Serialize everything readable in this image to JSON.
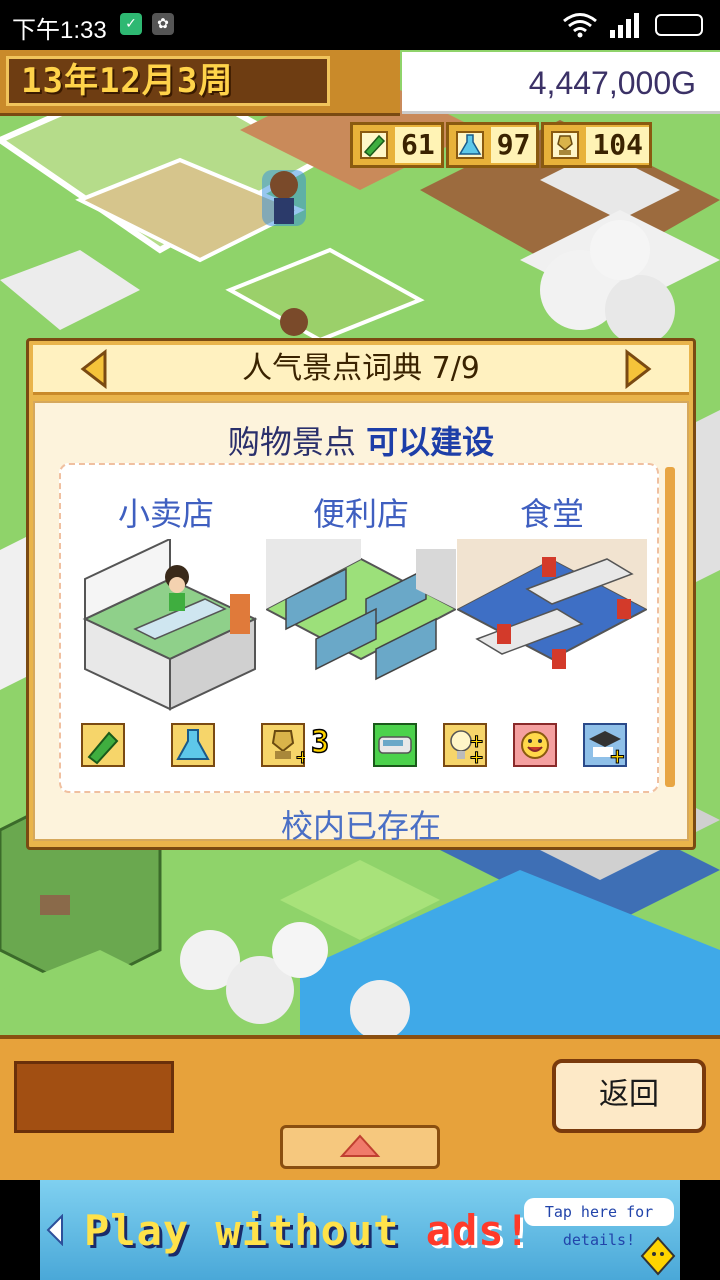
{
  "status_bar": {
    "time": "下午1:33"
  },
  "header": {
    "date": "13年12月3周",
    "money": "4,447,000G"
  },
  "stats": [
    {
      "icon": "pencil-icon",
      "value": "61"
    },
    {
      "icon": "flask-icon",
      "value": "97"
    },
    {
      "icon": "trophy-icon",
      "value": "104"
    }
  ],
  "dialog": {
    "title": "人气景点词典 7/9",
    "subtitle_prefix": "购物景点",
    "subtitle_status": "可以建设",
    "items": [
      {
        "name": "小卖店"
      },
      {
        "name": "便利店"
      },
      {
        "name": "食堂"
      }
    ],
    "requirements": [
      {
        "icon": "pencil-icon",
        "label": ""
      },
      {
        "icon": "flask-icon",
        "label": ""
      },
      {
        "icon": "trophy-plus-icon",
        "label": "3"
      },
      {
        "icon": "bus-icon",
        "label": ""
      },
      {
        "icon": "idea-plus-icon",
        "label": ""
      },
      {
        "icon": "smile-icon",
        "label": ""
      },
      {
        "icon": "graduate-plus-icon",
        "label": ""
      }
    ],
    "footer": "校内已存在"
  },
  "bottom_bar": {
    "back_label": "返回"
  },
  "ad": {
    "text_main": "Play without",
    "text_highlight": "ads!",
    "tip": "Tap here for details!"
  }
}
